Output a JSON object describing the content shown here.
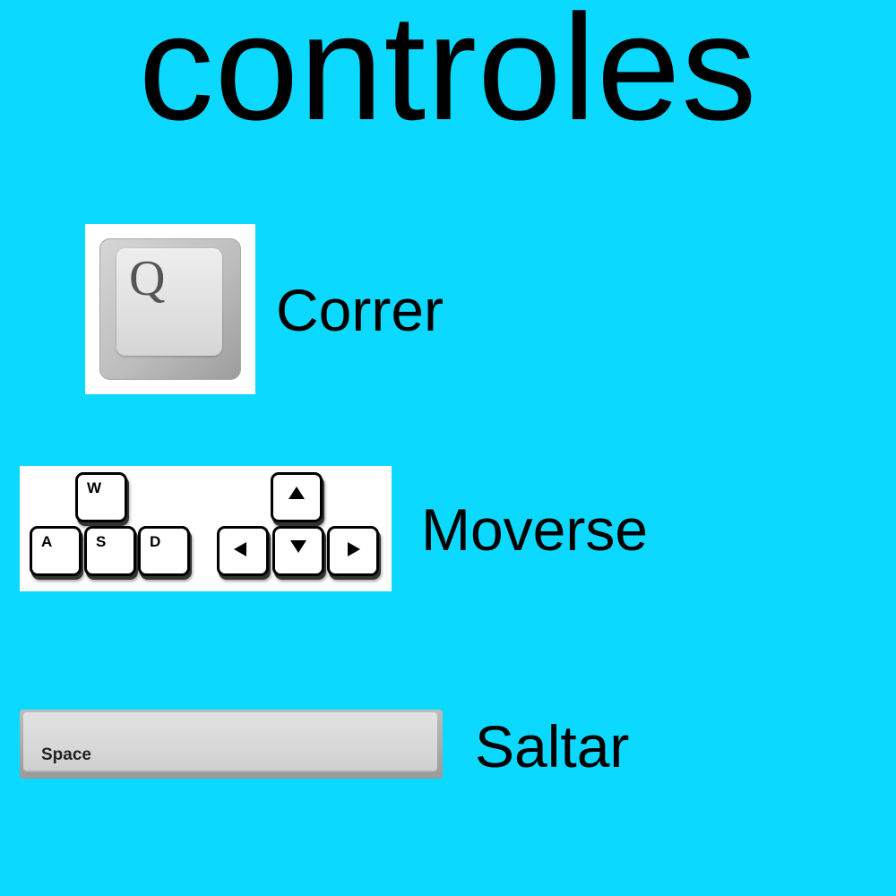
{
  "title": "controles",
  "colors": {
    "background": "#0cd9ff",
    "text": "#000000"
  },
  "controls": [
    {
      "action": "Correr",
      "keys": [
        "Q"
      ],
      "icon": "q-key-icon"
    },
    {
      "action": "Moverse",
      "keys": [
        "W",
        "A",
        "S",
        "D"
      ],
      "arrow_keys": [
        "up-arrow",
        "left-arrow",
        "down-arrow",
        "right-arrow"
      ],
      "icon": "wasd-arrow-keys-icon"
    },
    {
      "action": "Saltar",
      "keys": [
        "Space"
      ],
      "icon": "space-key-icon"
    }
  ]
}
